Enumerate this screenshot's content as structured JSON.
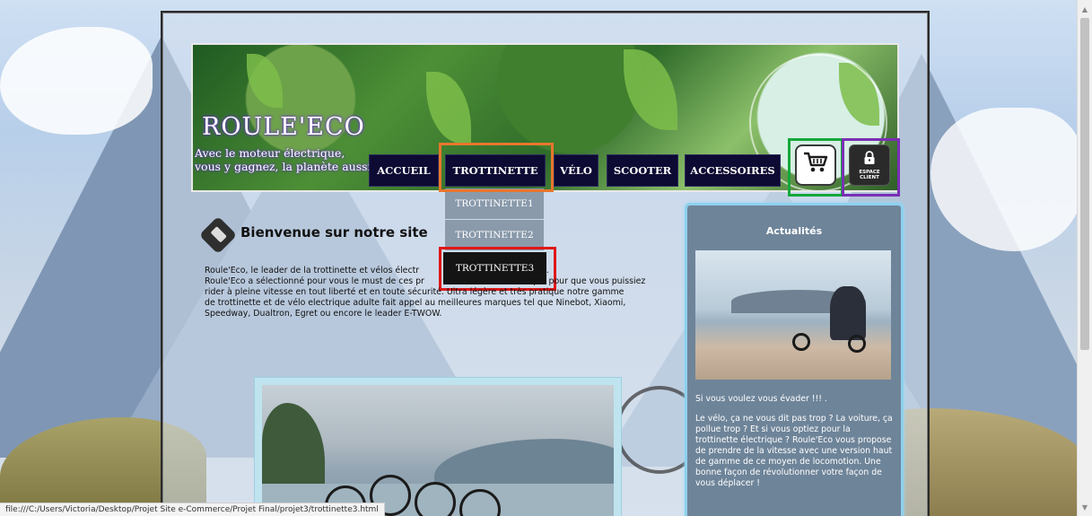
{
  "site": {
    "brand_title": "ROULE'ECO",
    "tagline_line1": "Avec le moteur électrique,",
    "tagline_line2": "vous y gagnez, la planète aussi."
  },
  "nav": {
    "items": [
      {
        "label": "ACCUEIL"
      },
      {
        "label": "TROTTINETTE"
      },
      {
        "label": "VÉLO"
      },
      {
        "label": "SCOOTER"
      },
      {
        "label": "ACCESSOIRES"
      }
    ],
    "dropdown": [
      {
        "label": "TROTTINETTE1"
      },
      {
        "label": "TROTTINETTE2"
      },
      {
        "label": "TROTTINETTE3"
      }
    ]
  },
  "header_icons": {
    "cart_icon": "cart-icon",
    "client_icon": "lock-icon",
    "client_line1": "ESPACE",
    "client_line2": "CLIENT"
  },
  "welcome": {
    "title": "Bienvenue sur notre site",
    "line1": "Roule'Eco, le leader de la trottinette et vélos électr",
    "line1_end": "e.",
    "line2_start": "Roule'Eco a sélectionné pour vous le must de ces pr",
    "line2_end": "que pour que vous puissiez",
    "line3": "rider à pleine vitesse en tout liberté et en toute sécurité. Ultra légère et très pratique notre gamme",
    "line4": "de trottinette et de vélo electrique adulte fait appel au meilleures marques tel que Ninebot, Xiaomi,",
    "line5": "Speedway, Dualtron, Egret ou encore le leader E-TWOW."
  },
  "news": {
    "title": "Actualités",
    "p1": "Si vous voulez vous évader !!! .",
    "p2": "Le vélo, ça ne vous dit pas trop ? La voiture, ça pollue trop  ? Et si vous optiez pour la trottinette électrique  ? Roule'Eco vous propose de prendre de la vitesse avec une version haut de gamme de ce moyen de locomotion. Une bonne façon de révolutionner votre façon de vous déplacer  !"
  },
  "status_bar": {
    "url": "file:///C:/Users/Victoria/Desktop/Projet Site e-Commerce/Projet Final/projet3/trottinette3.html"
  },
  "colors": {
    "nav_bg": "#0d0a33",
    "highlight_orange": "#e8762d",
    "highlight_red": "#e01717",
    "highlight_green": "#14a83a",
    "highlight_purple": "#7a2fb5",
    "panel_bg": "#6e8499"
  }
}
